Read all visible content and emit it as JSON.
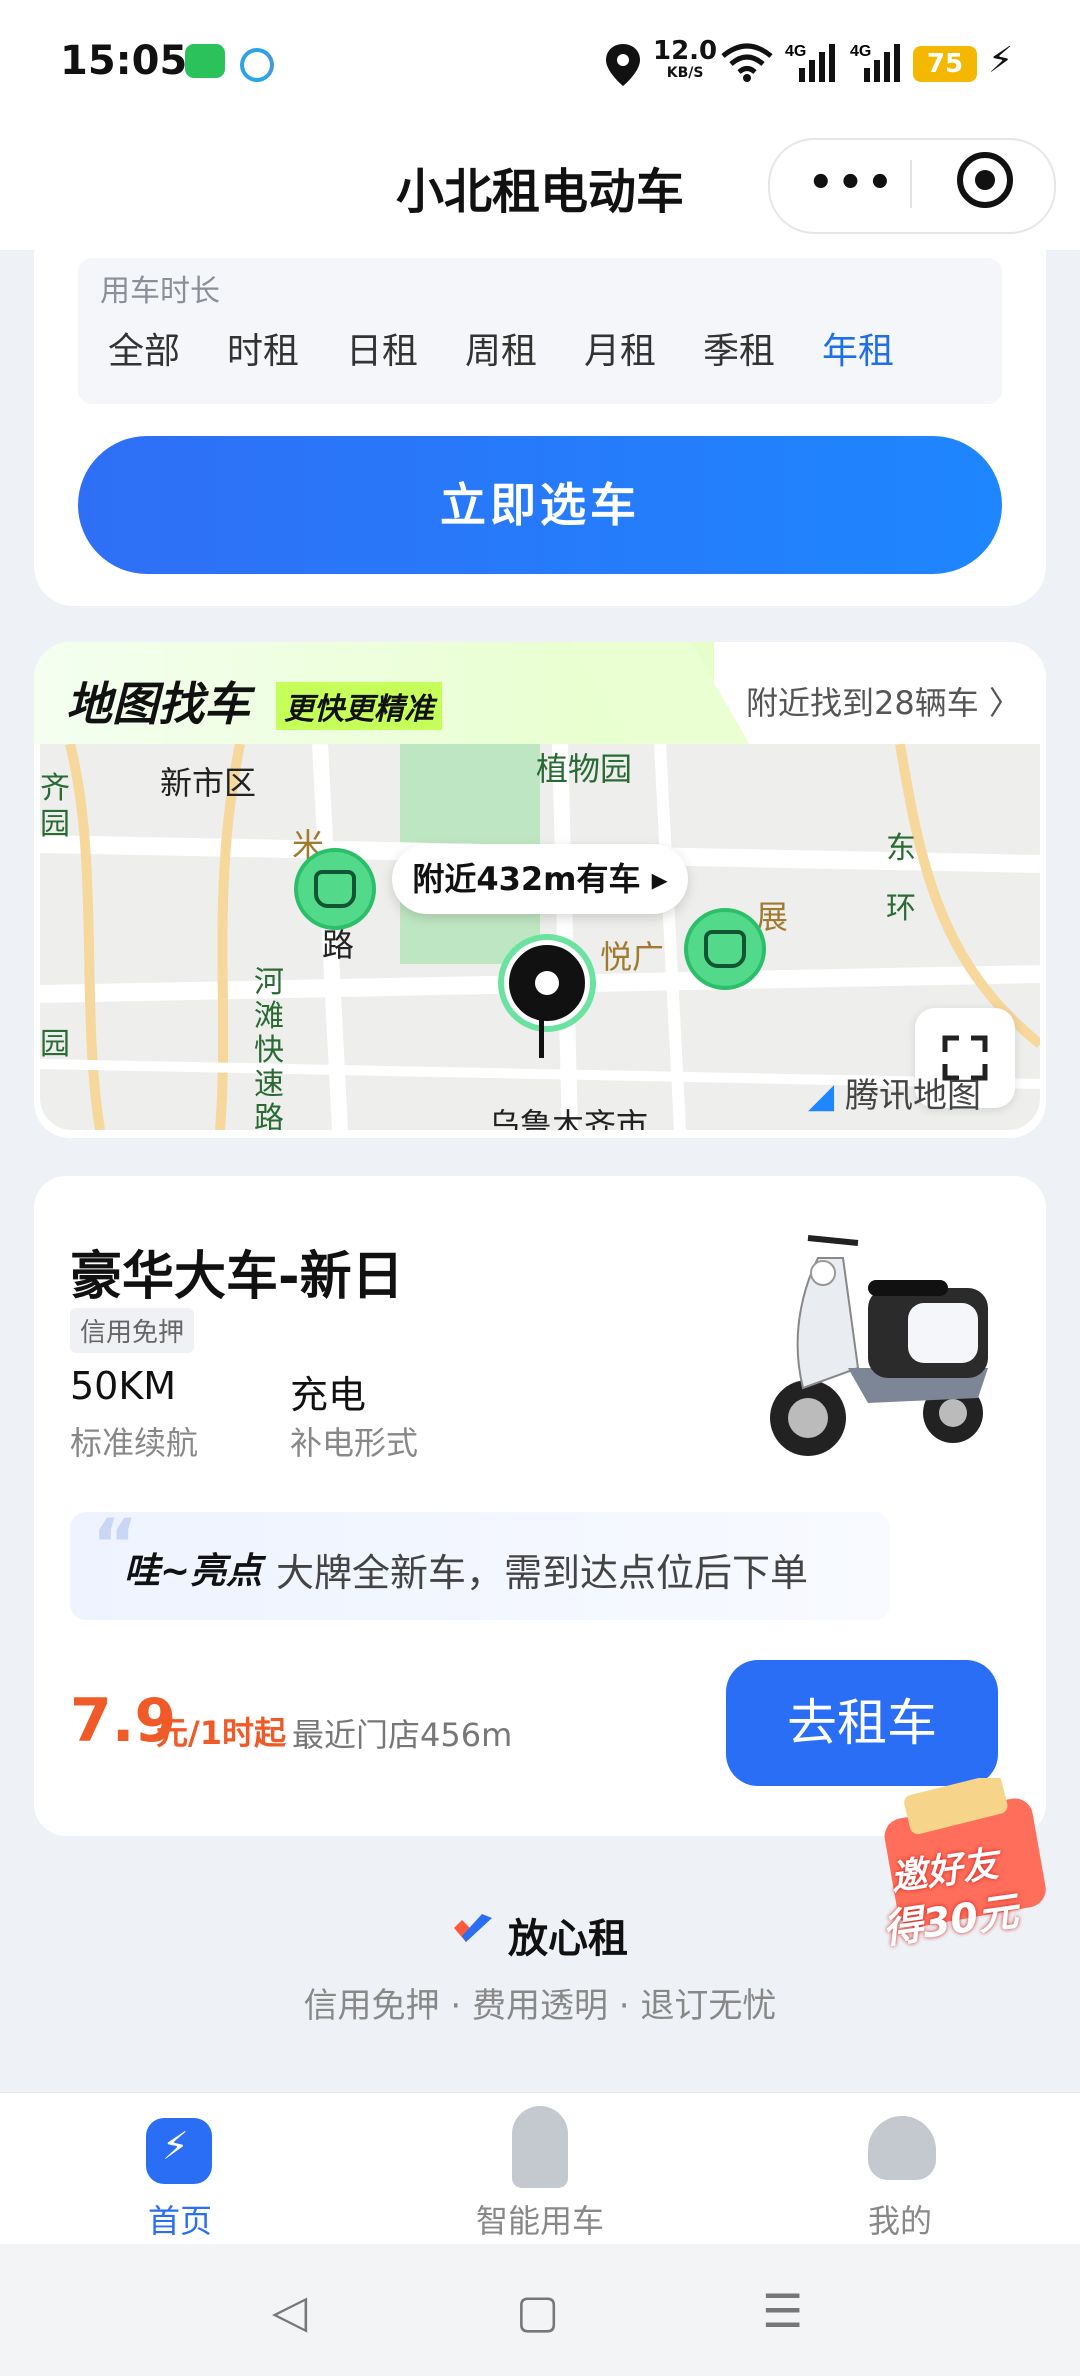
{
  "status": {
    "time": "15:05",
    "speed": "12.0",
    "speed_unit": "KB/S",
    "net1": "4G",
    "net2": "4G",
    "battery": "75"
  },
  "header": {
    "title": "小北租电动车",
    "more": "•••"
  },
  "duration": {
    "label": "用车时长",
    "options": [
      "全部",
      "时租",
      "日租",
      "周租",
      "月租",
      "季租",
      "年租"
    ],
    "selected": "年租"
  },
  "select_button": "立即选车",
  "map": {
    "title": "地图找车",
    "subtitle": "更快更精准",
    "found": "附近找到28辆车 〉",
    "bubble": "附近432m有车",
    "labels": {
      "district": "新市区",
      "botanic": "植物园",
      "urumqi": "乌鲁木齐市",
      "hetan": "河滩快速路",
      "mi": "米",
      "lu": "路",
      "qi": "齐",
      "yuan1": "园",
      "yuan2": "园",
      "dong": "东",
      "huan": "环",
      "zhan": "展",
      "yue": "悦广"
    },
    "provider": "腾讯地图"
  },
  "vehicle": {
    "name": "豪华大车-新日",
    "badge": "信用免押",
    "range_value": "50KM",
    "range_label": "标准续航",
    "charge_value": "充电",
    "charge_label": "补电形式",
    "highlight_title": "哇~亮点",
    "highlight_text": "大牌全新车，需到达点位后下单",
    "price": "7.9",
    "price_unit": "元/1时起",
    "nearest": "最近门店456m",
    "rent_button": "去租车"
  },
  "invite": {
    "line1": "邀好友",
    "line2": "得30元"
  },
  "trust": {
    "title": "放心租",
    "sub": "信用免押 · 费用透明 · 退订无忧"
  },
  "tabs": [
    "首页",
    "智能用车",
    "我的"
  ],
  "colors": {
    "primary": "#2a6ef6",
    "price": "#f05a28",
    "map_green": "#52d98a"
  }
}
